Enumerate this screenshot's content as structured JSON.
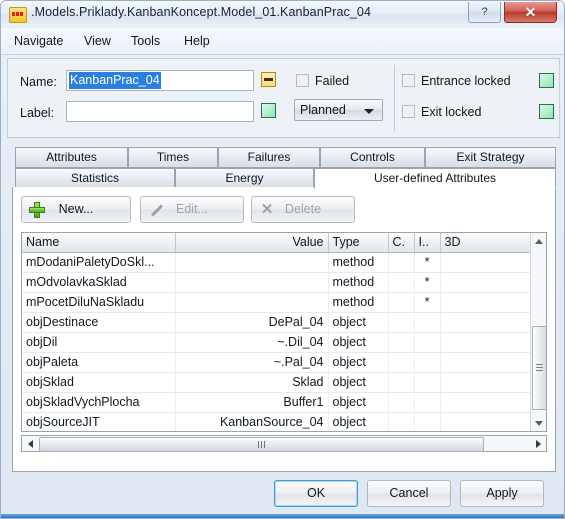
{
  "window": {
    "title": ".Models.Priklady.KanbanKoncept.Model_01.KanbanPrac_04",
    "app_icon": "machine-icon",
    "help_button": "?",
    "close_button": "✕"
  },
  "menubar": {
    "items": [
      {
        "label": "Navigate"
      },
      {
        "label": "View"
      },
      {
        "label": "Tools"
      },
      {
        "label": "Help"
      }
    ]
  },
  "form": {
    "name_label": "Name:",
    "name_value": "KanbanPrac_04",
    "name_placeholder": "",
    "label_label": "Label:",
    "label_value": "",
    "label_placeholder": "",
    "name_swatch_color": "#f7dd7d",
    "label_swatch_color": "#8fe6b0",
    "failed_checkbox_label": "Failed",
    "failed_checked": false,
    "state_combo_value": "Planned",
    "state_combo_options": [
      "Planned"
    ],
    "entrance_locked_label": "Entrance locked",
    "entrance_locked_checked": false,
    "exit_locked_label": "Exit locked",
    "exit_locked_checked": false,
    "entrance_swatch_color": "#8fe6b0",
    "exit_swatch_color": "#8fe6b0"
  },
  "tabs": {
    "row1": [
      {
        "label": "Attributes",
        "selected": false
      },
      {
        "label": "Times",
        "selected": false
      },
      {
        "label": "Failures",
        "selected": false
      },
      {
        "label": "Controls",
        "selected": false
      },
      {
        "label": "Exit Strategy",
        "selected": false
      }
    ],
    "row2": [
      {
        "label": "Statistics",
        "selected": false
      },
      {
        "label": "Energy",
        "selected": false
      },
      {
        "label": "User-defined Attributes",
        "selected": true
      }
    ]
  },
  "toolbar": {
    "new_label": "New...",
    "new_icon": "plus-icon",
    "edit_label": "Edit...",
    "edit_icon": "pencil-icon",
    "edit_enabled": false,
    "delete_label": "Delete",
    "delete_icon": "x-icon",
    "delete_enabled": false
  },
  "table": {
    "columns": [
      "Name",
      "Value",
      "Type",
      "C.",
      "I..",
      "3D"
    ],
    "rows": [
      {
        "name": "mDodaniPaletyDoSkl...",
        "value": "",
        "type": "method",
        "c": "",
        "i": "*",
        "d3": ""
      },
      {
        "name": "mOdvolavkaSklad",
        "value": "",
        "type": "method",
        "c": "",
        "i": "*",
        "d3": ""
      },
      {
        "name": "mPocetDiluNaSkladu",
        "value": "",
        "type": "method",
        "c": "",
        "i": "*",
        "d3": ""
      },
      {
        "name": "objDestinace",
        "value": "DePal_04",
        "type": "object",
        "c": "",
        "i": "",
        "d3": ""
      },
      {
        "name": "objDil",
        "value": "~.Dil_04",
        "type": "object",
        "c": "",
        "i": "",
        "d3": ""
      },
      {
        "name": "objPaleta",
        "value": "~.Pal_04",
        "type": "object",
        "c": "",
        "i": "",
        "d3": ""
      },
      {
        "name": "objSklad",
        "value": "Sklad",
        "type": "object",
        "c": "",
        "i": "",
        "d3": ""
      },
      {
        "name": "objSkladVychPlocha",
        "value": "Buffer1",
        "type": "object",
        "c": "",
        "i": "",
        "d3": ""
      },
      {
        "name": "objSourceJIT",
        "value": "KanbanSource_04",
        "type": "object",
        "c": "",
        "i": "",
        "d3": ""
      }
    ]
  },
  "footer": {
    "ok_label": "OK",
    "cancel_label": "Cancel",
    "apply_label": "Apply"
  }
}
